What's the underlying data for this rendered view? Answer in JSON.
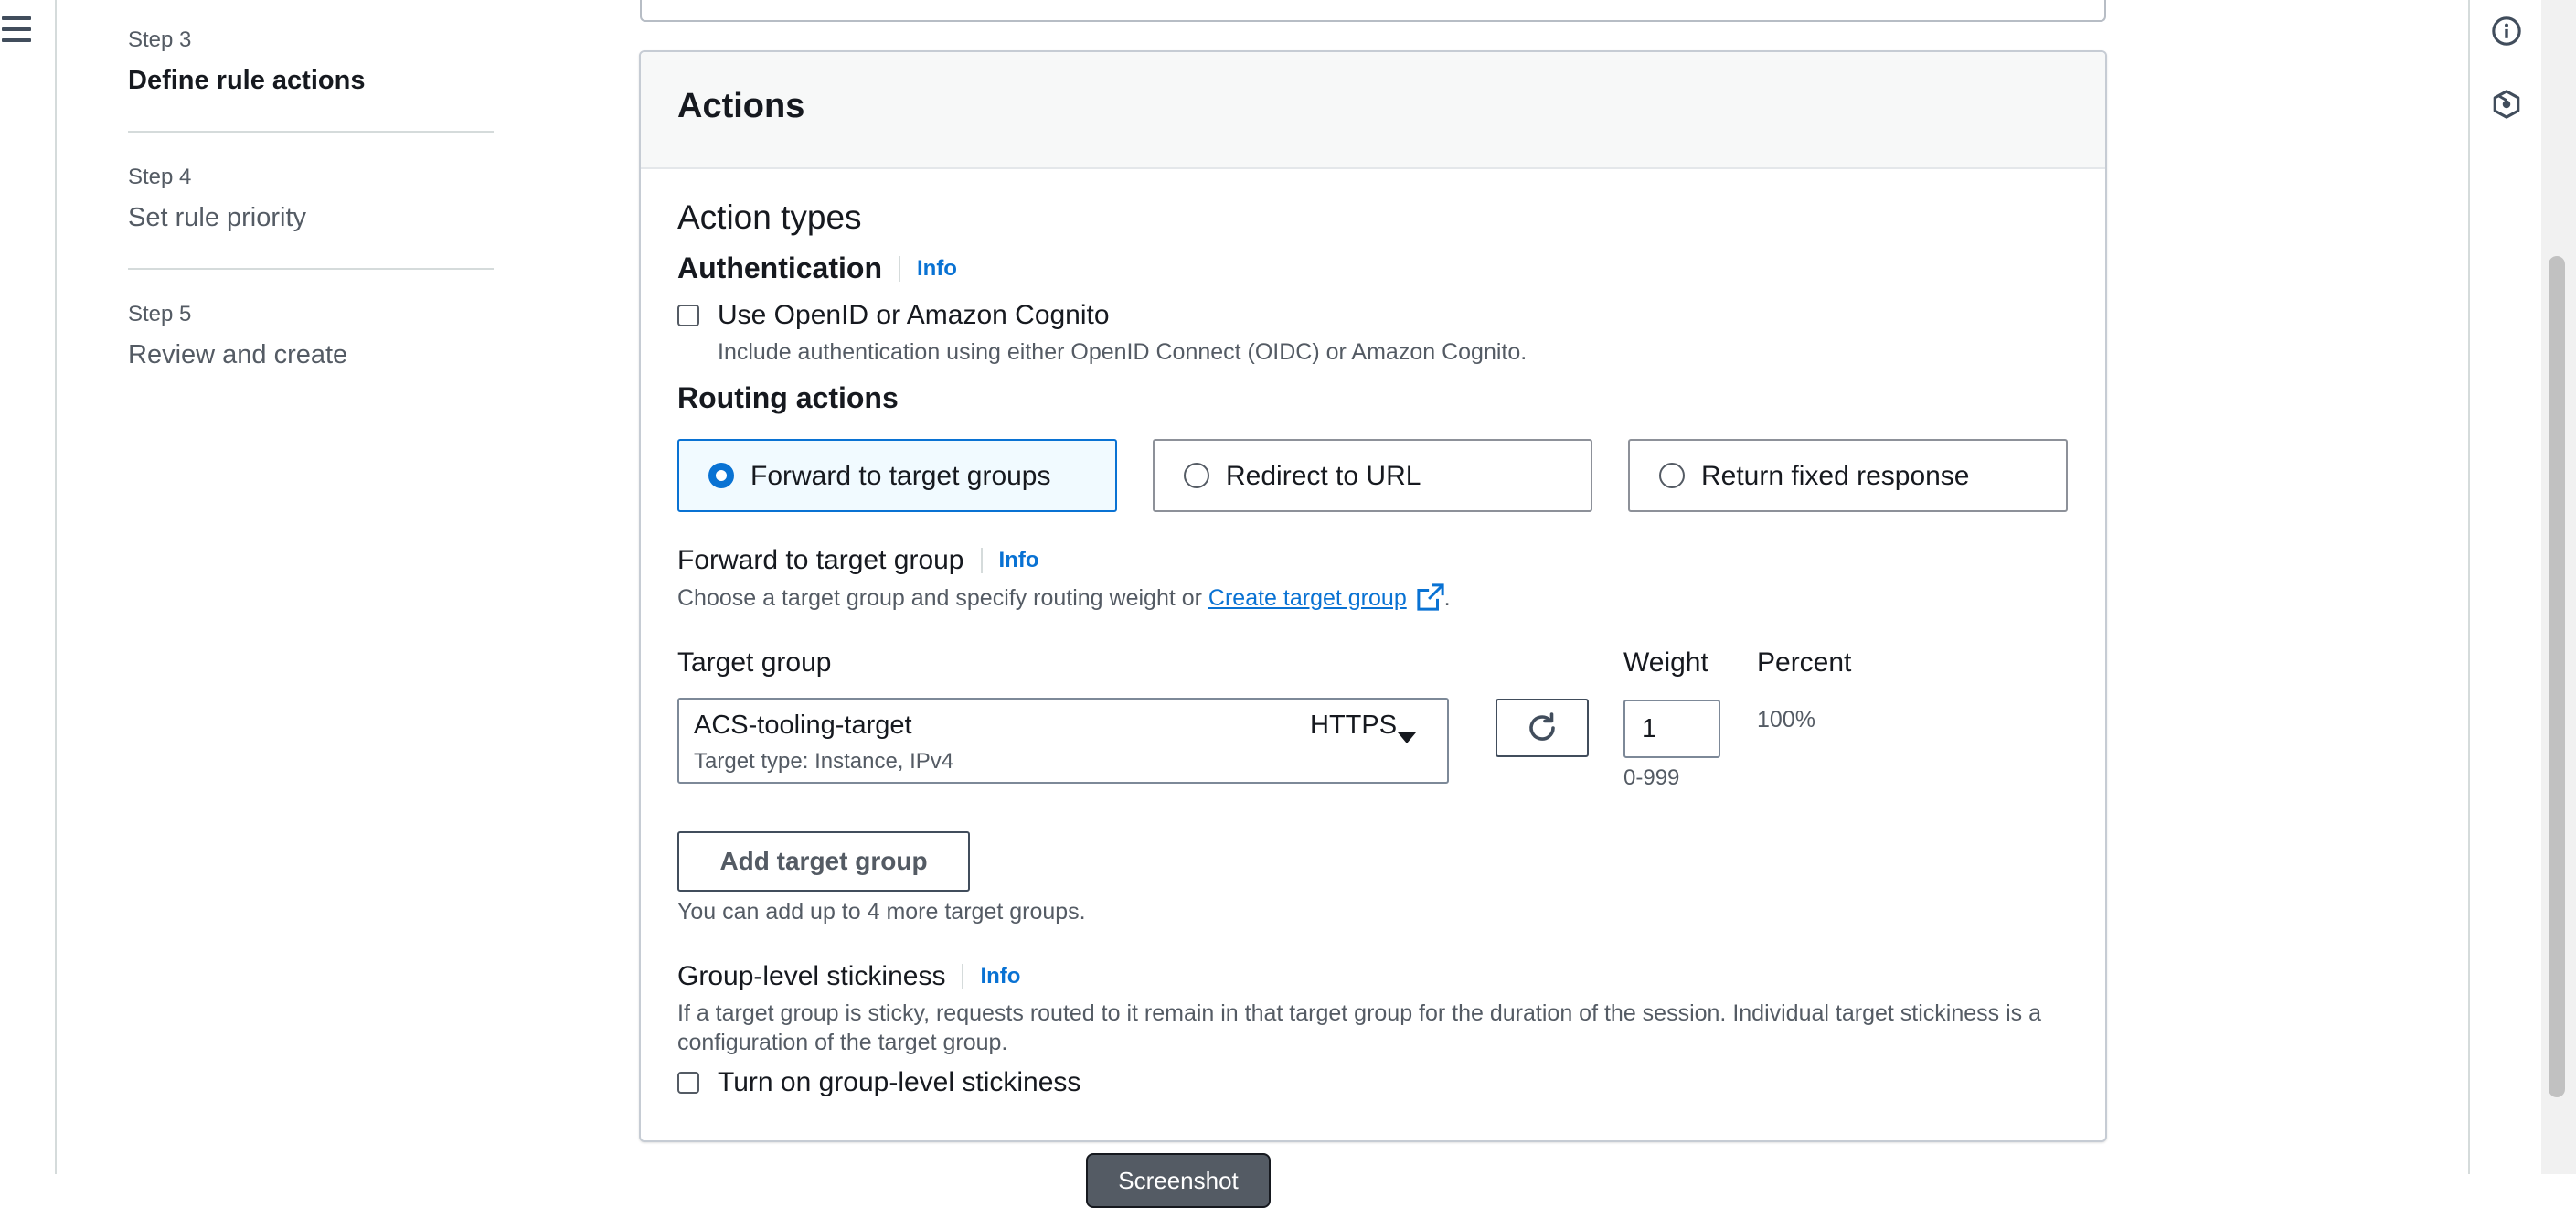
{
  "steps": [
    {
      "number": "Step 3",
      "title": "Define rule actions",
      "active": true
    },
    {
      "number": "Step 4",
      "title": "Set rule priority",
      "active": false
    },
    {
      "number": "Step 5",
      "title": "Review and create",
      "active": false
    }
  ],
  "panel": {
    "title": "Actions",
    "section_title": "Action types",
    "authentication": {
      "heading": "Authentication",
      "info": "Info",
      "checkbox_label": "Use OpenID or Amazon Cognito",
      "checkbox_desc": "Include authentication using either OpenID Connect (OIDC) or Amazon Cognito."
    },
    "routing": {
      "heading": "Routing actions",
      "options": [
        {
          "label": "Forward to target groups",
          "selected": true
        },
        {
          "label": "Redirect to URL",
          "selected": false
        },
        {
          "label": "Return fixed response",
          "selected": false
        }
      ]
    },
    "forward": {
      "heading": "Forward to target group",
      "info": "Info",
      "desc_prefix": "Choose a target group and specify routing weight or ",
      "create_link": "Create target group",
      "desc_suffix": "."
    },
    "target_table": {
      "col_target_group": "Target group",
      "col_weight": "Weight",
      "col_percent": "Percent",
      "target_name": "ACS-tooling-target",
      "target_protocol": "HTTPS",
      "target_type": "Target type: Instance, IPv4",
      "weight_value": "1",
      "weight_hint": "0-999",
      "percent_value": "100%"
    },
    "add_target_group": {
      "button": "Add target group",
      "hint": "You can add up to 4 more target groups."
    },
    "stickiness": {
      "heading": "Group-level stickiness",
      "info": "Info",
      "desc": "If a target group is sticky, requests routed to it remain in that target group for the duration of the session. Individual target stickiness is a configuration of the target group.",
      "checkbox_label": "Turn on group-level stickiness"
    }
  },
  "screenshot_button": "Screenshot",
  "icons": {
    "menu": "hamburger-menu-icon",
    "info": "info-circle-icon",
    "hexagon": "hexagon-icon",
    "refresh": "refresh-icon",
    "external": "external-link-icon",
    "dropdown": "caret-down-icon"
  },
  "colors": {
    "accent": "#0972d3",
    "text": "#16191f",
    "muted": "#545b64",
    "selected_bg": "#f1faff"
  }
}
